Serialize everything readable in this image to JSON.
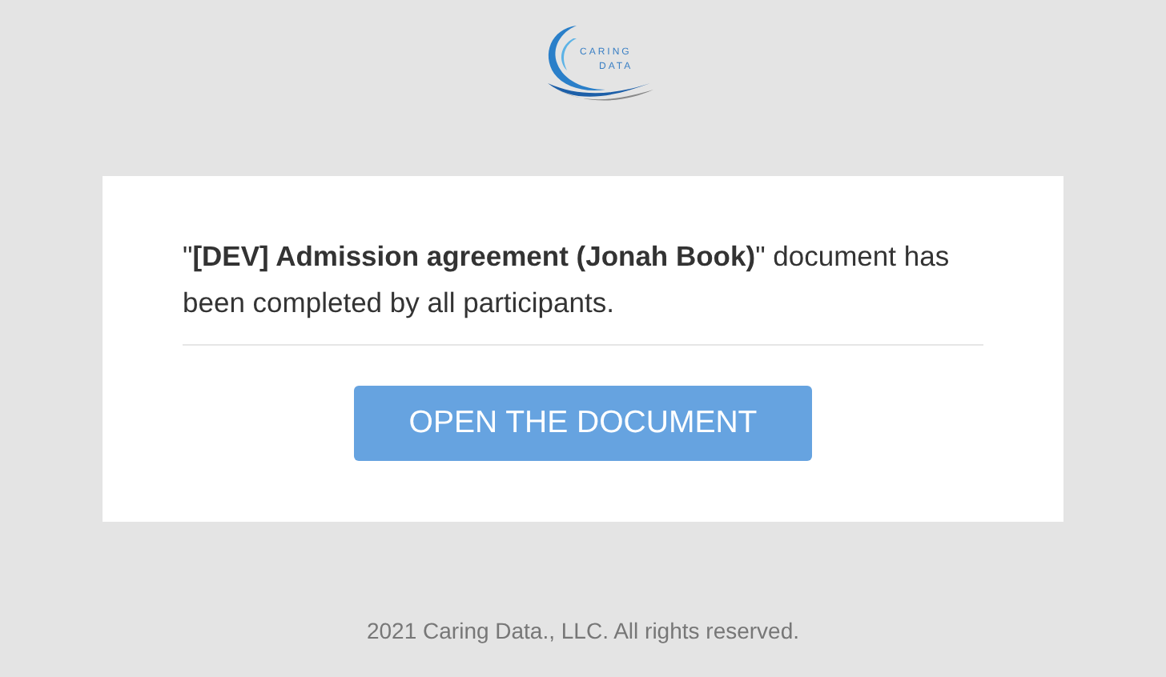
{
  "logo": {
    "line_1": "CARING",
    "line_2": "DATA"
  },
  "message": "\"**[DEV] Admission agreement (Jonah Book)**\" document has been completed by all participants.",
  "button": {
    "label": "OPEN THE DOCUMENT"
  },
  "footer": "2021 Caring Data., LLC. All rights reserved."
}
